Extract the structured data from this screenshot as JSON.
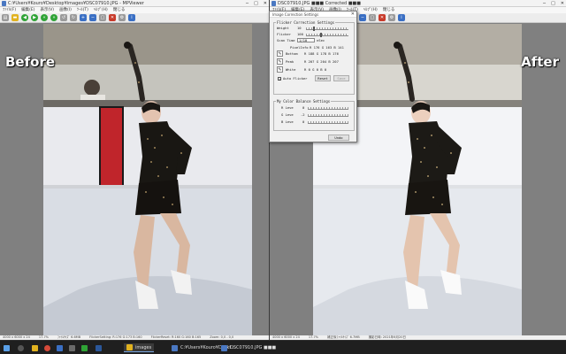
{
  "left_window": {
    "title": "C:¥Users¥Kouro¥Desktop¥images¥DSC07910.JPG - MPViewer",
    "menu": [
      "ﾌｧｲﾙ(F)",
      "編集(E)",
      "表示(V)",
      "画像(I)",
      "ﾂｰﾙ(T)",
      "ﾍﾙﾌﾟ(H)",
      "閉じる"
    ],
    "status": [
      "4000 x 6000 x 24",
      "17.7%",
      "ﾌｧｲﾙｻｲｽﾞ 6.6MB",
      "FlickerSetting: R:176 G:173 B:160",
      "FlickerReset: R:160 G:160 B:165",
      "Zoom: 0,0 - 0,0"
    ],
    "overlay_label": "Before"
  },
  "right_window": {
    "title": "DSC07910.JPG ■■■ Corrected ■■■",
    "menu": [
      "ﾌｧｲﾙ(F)",
      "編集(E)",
      "表示(V)",
      "画像(I)",
      "ﾂｰﾙ(T)",
      "ﾍﾙﾌﾟ(H)",
      "閉じる"
    ],
    "status": [
      "4000 x 6000 x 24",
      "17.7%",
      "補正後ﾌｧｲﾙｻｲｽﾞ 6.7MB",
      "撮影日時: 2021年6月20日"
    ],
    "overlay_label": "After"
  },
  "dialog": {
    "title": "Image Correction Settings",
    "flicker": {
      "group_label": "Flicker Correction Settings",
      "weight_label": "Weight",
      "weight_value": "10",
      "flicker_label": "Flicker",
      "flicker_value": "100",
      "scan_time_label": "Scan Time",
      "scan_time_value": "1/10",
      "scan_time_unit": "nSec",
      "pixelinfo_label": "PixelInfo",
      "pixelinfo_value": "R 176 G 163 B 141",
      "bottom_label": "Bottom",
      "bottom_value": "R 188 G 178 B 176",
      "peak_label": "Peak",
      "peak_value": "R 207 G 204 B 207",
      "white_label": "White",
      "white_value": "R 0   G 0   B 0",
      "auto_flicker_label": "Auto Flicker",
      "auto_flicker_checked": true,
      "reset_label": "Reset",
      "save_label": "Save"
    },
    "color_balance": {
      "group_label": "My Color Balance Settings",
      "r_label": "R Leve",
      "r_value": "0",
      "g_label": "G Leve",
      "g_value": "-2",
      "b_label": "B Leve",
      "b_value": "0"
    },
    "close_label": "Undo"
  },
  "taskbar": {
    "items": [
      "images",
      "C:¥Users¥Kouro¥Deskt...",
      "DSC07910.JPG ■■■"
    ]
  },
  "colors": {
    "window_bg": "#808080",
    "taskbar_bg": "#1f1f1f",
    "toolbar_green": "#2fa336",
    "dress": "#191713",
    "ice": "#d9dde4"
  }
}
